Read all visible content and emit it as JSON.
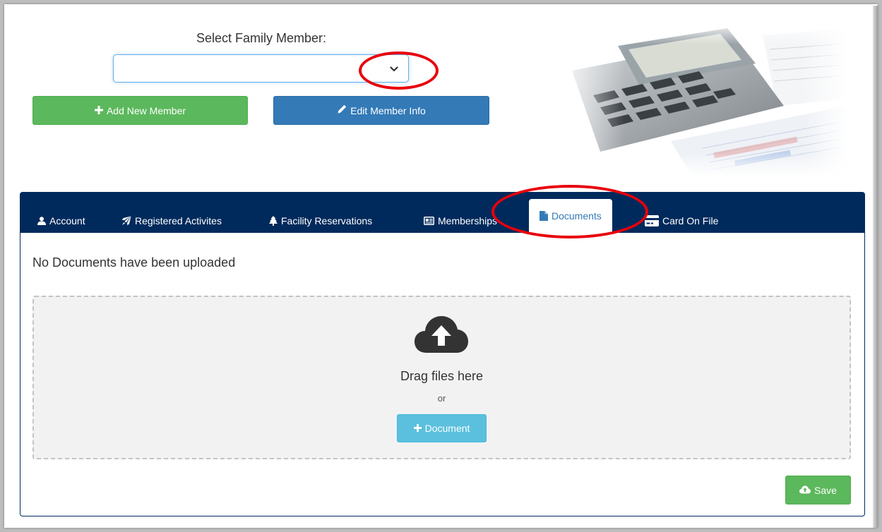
{
  "family": {
    "select_label": "Select Family Member:",
    "selected_value": ""
  },
  "buttons": {
    "add_member": "Add New Member",
    "edit_member": "Edit Member Info",
    "add_document": "Document",
    "save": "Save"
  },
  "tabs": [
    {
      "label": "Account",
      "icon": "user-icon",
      "active": false
    },
    {
      "label": "Registered Activites",
      "icon": "rocket-icon",
      "active": false
    },
    {
      "label": "Facility Reservations",
      "icon": "tree-icon",
      "active": false
    },
    {
      "label": "Memberships",
      "icon": "id-card-icon",
      "active": false
    },
    {
      "label": "Documents",
      "icon": "file-icon",
      "active": true
    },
    {
      "label": "Card On File",
      "icon": "credit-card-icon",
      "active": false
    }
  ],
  "documents": {
    "empty_message": "No Documents have been uploaded",
    "drop_text": "Drag files here",
    "or_text": "or"
  },
  "colors": {
    "navy": "#002a5c",
    "green": "#5cb85c",
    "blue": "#337ab7",
    "info": "#5bc0de",
    "annotation_red": "#e8000b"
  }
}
